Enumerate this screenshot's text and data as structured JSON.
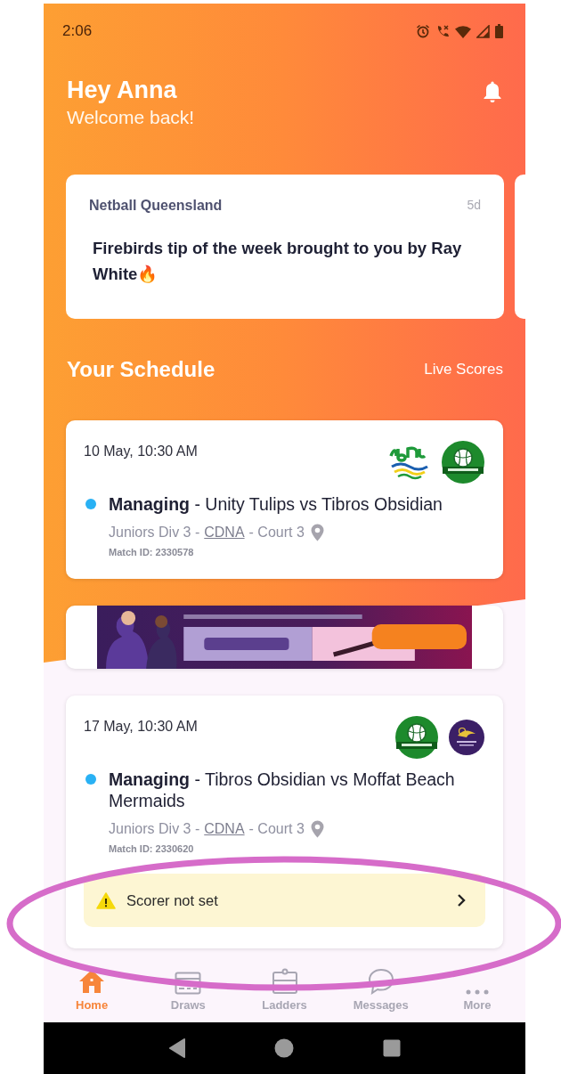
{
  "status_bar": {
    "time": "2:06"
  },
  "header": {
    "greeting": "Hey Anna",
    "subtitle": "Welcome back!"
  },
  "news": [
    {
      "source": "Netball Queensland",
      "age": "5d",
      "title": "Firebirds tip of the week brought to you by Ray White🔥"
    }
  ],
  "schedule": {
    "title": "Your Schedule",
    "link": "Live Scores",
    "items": [
      {
        "kind": "match",
        "date": "10 May, 10:30 AM",
        "logos": [
          {
            "kind": "wave"
          },
          {
            "kind": "ball"
          }
        ],
        "title": "**Managing** - Unity Tulips vs Tibros Obsidian",
        "division": "Juniors Div 3 -",
        "venue": "CDNA",
        "court": "- Court 3",
        "match_id": "Match ID: 2330578"
      },
      {
        "kind": "ad"
      },
      {
        "kind": "match",
        "date": "17 May, 10:30 AM",
        "logos": [
          {
            "kind": "ball"
          },
          {
            "kind": "crest"
          }
        ],
        "title": "**Managing** - Tibros Obsidian vs Moffat Beach Mermaids",
        "division": "Juniors Div 3 -",
        "venue": "CDNA",
        "court": "- Court 3",
        "match_id": "Match ID: 2330620",
        "alert": "Scorer not set"
      }
    ]
  },
  "nav": [
    {
      "label": "Home",
      "selected": true
    },
    {
      "label": "Draws",
      "selected": false
    },
    {
      "label": "Ladders",
      "selected": false
    },
    {
      "label": "Messages",
      "selected": false
    },
    {
      "label": "More",
      "selected": false
    }
  ]
}
